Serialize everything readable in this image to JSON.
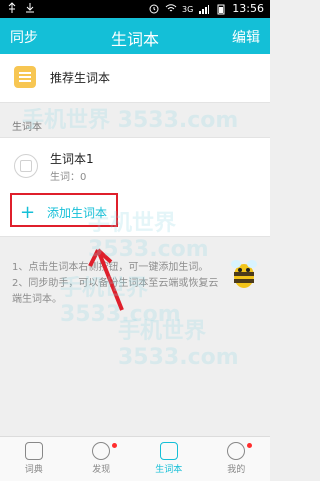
{
  "status_bar": {
    "time": "13:56",
    "network": "3G",
    "icons": [
      "usb-icon",
      "download-icon",
      "alarm-icon",
      "wifi-icon",
      "signal-icon",
      "battery-icon"
    ]
  },
  "app_bar": {
    "left": "同步",
    "title": "生词本",
    "right": "编辑"
  },
  "recommended": {
    "label": "推荐生词本"
  },
  "section": {
    "label": "生词本"
  },
  "book": {
    "title": "生词本1",
    "meta": "生词：0"
  },
  "add_book": {
    "label": "添加生词本"
  },
  "help_text": {
    "line1": "1、点击生词本右侧按钮，可一键添加生词。",
    "line2": "2、同步助手，可以备份生词本至云端或恢复云端生词本。"
  },
  "tabs": [
    {
      "label": "词典",
      "icon": "book-tab-icon"
    },
    {
      "label": "发现",
      "icon": "compass-tab-icon"
    },
    {
      "label": "生词本",
      "icon": "notebook-tab-icon"
    },
    {
      "label": "我的",
      "icon": "user-tab-icon"
    }
  ],
  "colors": {
    "accent": "#14bfd7",
    "highlight": "#df1f2b",
    "badge": "#ff2d2d"
  },
  "watermark": "手机世界 3533.com"
}
